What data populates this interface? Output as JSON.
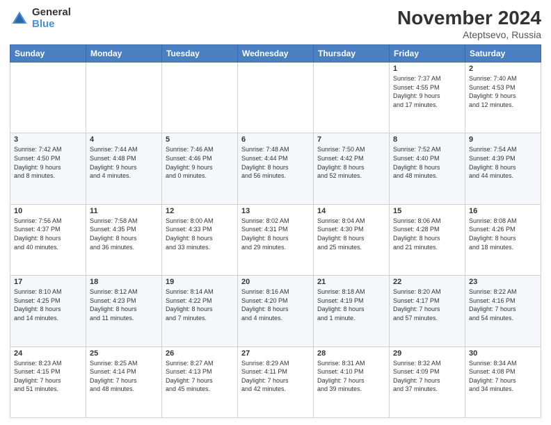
{
  "logo": {
    "line1": "General",
    "line2": "Blue"
  },
  "title": "November 2024",
  "location": "Ateptsevo, Russia",
  "headers": [
    "Sunday",
    "Monday",
    "Tuesday",
    "Wednesday",
    "Thursday",
    "Friday",
    "Saturday"
  ],
  "rows": [
    [
      {
        "day": "",
        "info": ""
      },
      {
        "day": "",
        "info": ""
      },
      {
        "day": "",
        "info": ""
      },
      {
        "day": "",
        "info": ""
      },
      {
        "day": "",
        "info": ""
      },
      {
        "day": "1",
        "info": "Sunrise: 7:37 AM\nSunset: 4:55 PM\nDaylight: 9 hours\nand 17 minutes."
      },
      {
        "day": "2",
        "info": "Sunrise: 7:40 AM\nSunset: 4:53 PM\nDaylight: 9 hours\nand 12 minutes."
      }
    ],
    [
      {
        "day": "3",
        "info": "Sunrise: 7:42 AM\nSunset: 4:50 PM\nDaylight: 9 hours\nand 8 minutes."
      },
      {
        "day": "4",
        "info": "Sunrise: 7:44 AM\nSunset: 4:48 PM\nDaylight: 9 hours\nand 4 minutes."
      },
      {
        "day": "5",
        "info": "Sunrise: 7:46 AM\nSunset: 4:46 PM\nDaylight: 9 hours\nand 0 minutes."
      },
      {
        "day": "6",
        "info": "Sunrise: 7:48 AM\nSunset: 4:44 PM\nDaylight: 8 hours\nand 56 minutes."
      },
      {
        "day": "7",
        "info": "Sunrise: 7:50 AM\nSunset: 4:42 PM\nDaylight: 8 hours\nand 52 minutes."
      },
      {
        "day": "8",
        "info": "Sunrise: 7:52 AM\nSunset: 4:40 PM\nDaylight: 8 hours\nand 48 minutes."
      },
      {
        "day": "9",
        "info": "Sunrise: 7:54 AM\nSunset: 4:39 PM\nDaylight: 8 hours\nand 44 minutes."
      }
    ],
    [
      {
        "day": "10",
        "info": "Sunrise: 7:56 AM\nSunset: 4:37 PM\nDaylight: 8 hours\nand 40 minutes."
      },
      {
        "day": "11",
        "info": "Sunrise: 7:58 AM\nSunset: 4:35 PM\nDaylight: 8 hours\nand 36 minutes."
      },
      {
        "day": "12",
        "info": "Sunrise: 8:00 AM\nSunset: 4:33 PM\nDaylight: 8 hours\nand 33 minutes."
      },
      {
        "day": "13",
        "info": "Sunrise: 8:02 AM\nSunset: 4:31 PM\nDaylight: 8 hours\nand 29 minutes."
      },
      {
        "day": "14",
        "info": "Sunrise: 8:04 AM\nSunset: 4:30 PM\nDaylight: 8 hours\nand 25 minutes."
      },
      {
        "day": "15",
        "info": "Sunrise: 8:06 AM\nSunset: 4:28 PM\nDaylight: 8 hours\nand 21 minutes."
      },
      {
        "day": "16",
        "info": "Sunrise: 8:08 AM\nSunset: 4:26 PM\nDaylight: 8 hours\nand 18 minutes."
      }
    ],
    [
      {
        "day": "17",
        "info": "Sunrise: 8:10 AM\nSunset: 4:25 PM\nDaylight: 8 hours\nand 14 minutes."
      },
      {
        "day": "18",
        "info": "Sunrise: 8:12 AM\nSunset: 4:23 PM\nDaylight: 8 hours\nand 11 minutes."
      },
      {
        "day": "19",
        "info": "Sunrise: 8:14 AM\nSunset: 4:22 PM\nDaylight: 8 hours\nand 7 minutes."
      },
      {
        "day": "20",
        "info": "Sunrise: 8:16 AM\nSunset: 4:20 PM\nDaylight: 8 hours\nand 4 minutes."
      },
      {
        "day": "21",
        "info": "Sunrise: 8:18 AM\nSunset: 4:19 PM\nDaylight: 8 hours\nand 1 minute."
      },
      {
        "day": "22",
        "info": "Sunrise: 8:20 AM\nSunset: 4:17 PM\nDaylight: 7 hours\nand 57 minutes."
      },
      {
        "day": "23",
        "info": "Sunrise: 8:22 AM\nSunset: 4:16 PM\nDaylight: 7 hours\nand 54 minutes."
      }
    ],
    [
      {
        "day": "24",
        "info": "Sunrise: 8:23 AM\nSunset: 4:15 PM\nDaylight: 7 hours\nand 51 minutes."
      },
      {
        "day": "25",
        "info": "Sunrise: 8:25 AM\nSunset: 4:14 PM\nDaylight: 7 hours\nand 48 minutes."
      },
      {
        "day": "26",
        "info": "Sunrise: 8:27 AM\nSunset: 4:13 PM\nDaylight: 7 hours\nand 45 minutes."
      },
      {
        "day": "27",
        "info": "Sunrise: 8:29 AM\nSunset: 4:11 PM\nDaylight: 7 hours\nand 42 minutes."
      },
      {
        "day": "28",
        "info": "Sunrise: 8:31 AM\nSunset: 4:10 PM\nDaylight: 7 hours\nand 39 minutes."
      },
      {
        "day": "29",
        "info": "Sunrise: 8:32 AM\nSunset: 4:09 PM\nDaylight: 7 hours\nand 37 minutes."
      },
      {
        "day": "30",
        "info": "Sunrise: 8:34 AM\nSunset: 4:08 PM\nDaylight: 7 hours\nand 34 minutes."
      }
    ]
  ]
}
